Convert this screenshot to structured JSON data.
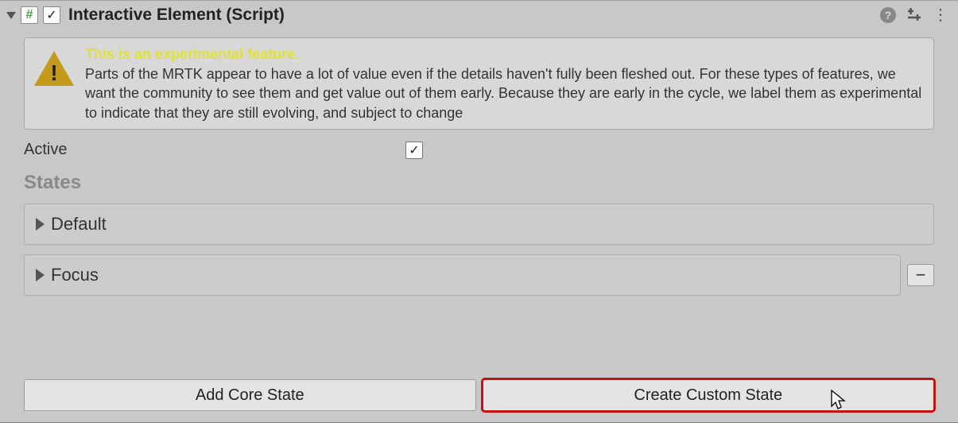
{
  "header": {
    "title": "Interactive Element (Script)",
    "enabled_check": "✓",
    "script_glyph": "#"
  },
  "warning": {
    "title": "This is an experimental feature.",
    "body": "Parts of the MRTK appear to have a lot of value even if the details haven't fully been fleshed out. For these types of features, we want the community to see them and get value out of them early. Because they are early in the cycle, we label them as experimental to indicate that they are still evolving, and subject to change"
  },
  "fields": {
    "active_label": "Active",
    "active_check": "✓"
  },
  "sections": {
    "states_title": "States"
  },
  "states": [
    {
      "name": "Default",
      "has_remove": false
    },
    {
      "name": "Focus",
      "has_remove": true
    }
  ],
  "buttons": {
    "add_core": "Add Core State",
    "create_custom": "Create Custom State",
    "minus": "−"
  },
  "icons": {
    "help": "?",
    "kebab": "⋮"
  }
}
